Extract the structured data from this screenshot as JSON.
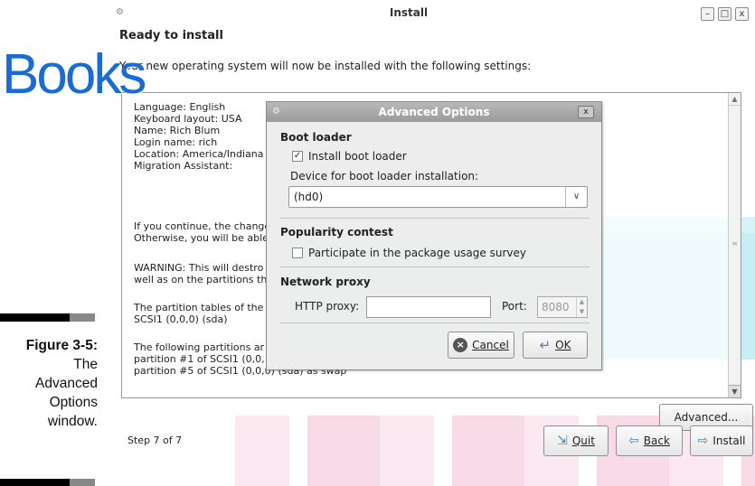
{
  "book": {
    "logo": "Books",
    "caption": {
      "figure": "Figure 3-5:",
      "lines": [
        "The",
        "Advanced",
        "Options",
        "window."
      ]
    }
  },
  "window": {
    "title": "Install",
    "controls": {
      "minimize": "–",
      "maximize": "□",
      "close": "x"
    },
    "heading": "Ready to install",
    "intro": "Your new operating system will now be installed with the following settings:",
    "summary": [
      "Language: English",
      "Keyboard layout: USA",
      "Name: Rich Blum",
      "Login name: rich",
      "Location: America/Indiana",
      "Migration Assistant:",
      "",
      "If you continue, the change",
      "Otherwise, you will be able",
      "WARNING: This will destro",
      "well as on the partitions th",
      "The partition tables of the",
      " SCSI1 (0,0,0) (sda)",
      "The following partitions ar",
      " partition #1 of SCSI1 (0,0,",
      " partition #5 of SCSI1 (0,0,0) (sda) as swap"
    ],
    "advanced_button": "Advanced...",
    "step": "Step 7 of 7",
    "buttons": {
      "quit": "Quit",
      "back": "Back",
      "install": "Install"
    }
  },
  "dialog": {
    "title": "Advanced Options",
    "close": "x",
    "boot_loader": {
      "heading": "Boot loader",
      "install_label": "Install boot loader",
      "install_checked": true,
      "device_label": "Device for boot loader installation:",
      "device_value": "(hd0)"
    },
    "popularity": {
      "heading": "Popularity contest",
      "survey_label": "Participate in the package usage survey",
      "survey_checked": false
    },
    "proxy": {
      "heading": "Network proxy",
      "http_label": "HTTP proxy:",
      "http_value": "",
      "port_label": "Port:",
      "port_value": "8080"
    },
    "cancel": "Cancel",
    "ok": "OK"
  },
  "colors": {
    "logo_blue": "#1a6cd4",
    "teal_background": "#c6eef3",
    "red_background": "#fbe6ef"
  }
}
